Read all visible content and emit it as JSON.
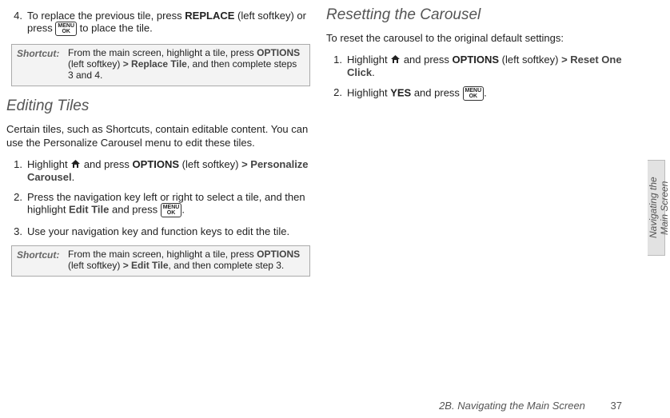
{
  "left": {
    "step4_num": "4.",
    "step4_a": "To replace the previous tile, press ",
    "step4_replace": "REPLACE",
    "step4_b": " (left softkey) or press ",
    "step4_c": " to place the tile.",
    "shortcut1_label": "Shortcut:",
    "shortcut1_a": "From the main screen, highlight a tile, press ",
    "shortcut1_options": "OPTIONS",
    "shortcut1_b": " (left softkey) ",
    "shortcut1_gt": ">",
    "shortcut1_replace": " Replace Tile",
    "shortcut1_c": ", and then complete steps 3 and 4.",
    "h_editing": "Editing Tiles",
    "para1": "Certain tiles, such as Shortcuts, contain editable content. You can use the Personalize Carousel menu to edit these tiles.",
    "s1_num": "1.",
    "s1_a": "Highlight ",
    "s1_b": " and press ",
    "s1_options": "OPTIONS",
    "s1_c": " (left softkey) ",
    "s1_gt": ">",
    "s1_personalize": " Personalize Carousel",
    "s1_d": ".",
    "s2_num": "2.",
    "s2_a": "Press the navigation key left or right to select a tile, and then highlight ",
    "s2_edit": "Edit Tile",
    "s2_b": " and press ",
    "s2_c": ".",
    "s3_num": "3.",
    "s3_text": "Use your navigation key and function keys to edit the tile.",
    "shortcut2_label": "Shortcut:",
    "shortcut2_a": "From the main screen, highlight a tile, press ",
    "shortcut2_options": "OPTIONS",
    "shortcut2_b": " (left softkey) ",
    "shortcut2_gt": ">",
    "shortcut2_edit": " Edit Tile",
    "shortcut2_c": ", and then complete step 3."
  },
  "right": {
    "h_reset": "Resetting the Carousel",
    "intro": "To reset the carousel to the original default settings:",
    "r1_num": "1.",
    "r1_a": "Highlight ",
    "r1_b": " and press ",
    "r1_options": "OPTIONS",
    "r1_c": " (left softkey) ",
    "r1_gt": ">",
    "r1_reset": " Reset One Click",
    "r1_d": ".",
    "r2_num": "2.",
    "r2_a": "Highlight ",
    "r2_yes": "YES",
    "r2_b": " and press ",
    "r2_c": "."
  },
  "side_tab": "Navigating the Main Screen",
  "footer_text": "2B. Navigating the Main Screen",
  "footer_page": "37",
  "ok_text": "MENU OK"
}
